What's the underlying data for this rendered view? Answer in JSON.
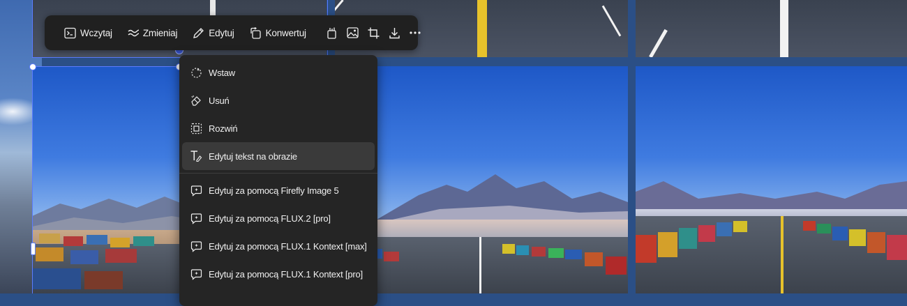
{
  "toolbar": {
    "load_label": "Wczytaj",
    "change_label": "Zmieniaj",
    "edit_label": "Edytuj",
    "convert_label": "Konwertuj"
  },
  "menu": {
    "items": [
      {
        "label": "Wstaw",
        "icon": "insert-sparkle-icon"
      },
      {
        "label": "Usuń",
        "icon": "eraser-icon"
      },
      {
        "label": "Rozwiń",
        "icon": "expand-icon"
      },
      {
        "label": "Edytuj tekst na obrazie",
        "icon": "text-edit-icon",
        "active": true
      }
    ],
    "model_items": [
      {
        "label": "Edytuj za pomocą Firefly Image 5",
        "icon": "ai-edit-icon"
      },
      {
        "label": "Edytuj za pomocą FLUX.2 [pro]",
        "icon": "ai-edit-icon"
      },
      {
        "label": "Edytuj za pomocą FLUX.1 Kontext [max]",
        "icon": "ai-edit-icon"
      },
      {
        "label": "Edytuj za pomocą FLUX.1 Kontext [pro]",
        "icon": "ai-edit-icon"
      }
    ]
  },
  "colors": {
    "toolbar_bg": "#202020",
    "menu_bg": "#252525",
    "menu_active": "#3a3a3a",
    "selection": "#5b7cff"
  }
}
